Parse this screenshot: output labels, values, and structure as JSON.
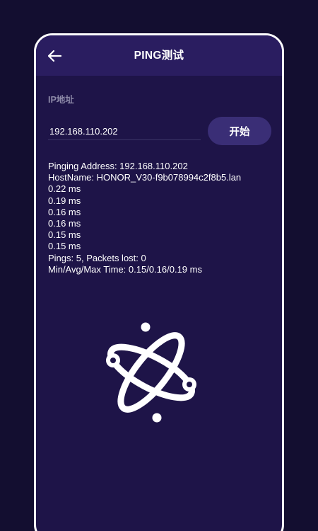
{
  "header": {
    "title": "PING测试",
    "back_icon": "arrow-left-icon"
  },
  "form": {
    "ip_label": "IP地址",
    "ip_value": "192.168.110.202",
    "start_label": "开始"
  },
  "output": {
    "lines": [
      "Pinging Address: 192.168.110.202",
      "HostName: HONOR_V30-f9b078994c2f8b5.lan",
      "0.22 ms",
      "0.19 ms",
      "0.16 ms",
      "0.16 ms",
      "0.15 ms",
      "0.15 ms",
      "Pings: 5, Packets lost: 0",
      "Min/Avg/Max Time: 0.15/0.16/0.19 ms"
    ]
  },
  "logo": {
    "icon": "atom-icon"
  },
  "colors": {
    "background": "#130e30",
    "panel": "#1e1448",
    "header": "#2a1d60",
    "button": "#3a2e76",
    "label": "#8d89a8",
    "text": "#ffffff"
  }
}
